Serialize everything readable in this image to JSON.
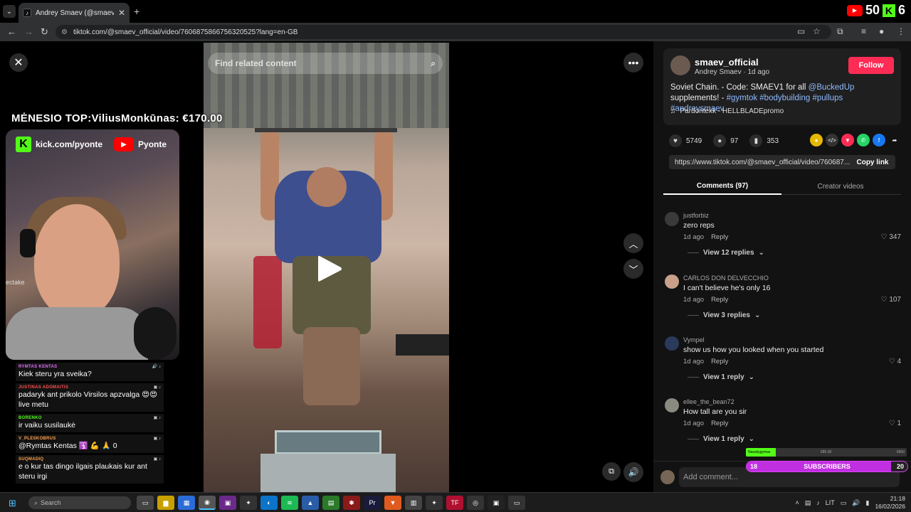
{
  "browser": {
    "tab_title": "Andrey Smaev (@smaev_of",
    "url": "tiktok.com/@smaev_official/video/7606875866756320525?lang=en-GB",
    "overlay_count_left": "50",
    "overlay_count_right": "6"
  },
  "video": {
    "search_placeholder": "Find related content"
  },
  "stream_overlay": {
    "banner": "MĖNESIO TOP:ViliusMonkūnas: €170.00",
    "kick_url": "kick.com/pyonte",
    "youtube_name": "Pyonte",
    "webcam_side_label": "ectake",
    "chat": [
      {
        "user": "RYMTAS KENTAS",
        "user_color": "#e56cff",
        "text": "Kiek steru yra sveika?"
      },
      {
        "user": "JUSTINAS ADOMAITIS",
        "user_color": "#ff4d4d",
        "text": "padaryk ant prikolo Virsilos apzvalga 😍😍 live metu"
      },
      {
        "user": "BORENKO",
        "user_color": "#53fc18",
        "text": "ir vaiku susilaukė"
      },
      {
        "user": "V_PLESKOBRUS",
        "user_color": "#ffa24d",
        "text": "@Rymtas Kentas 🛐 💪 🙏 0"
      },
      {
        "user": "SUQMADIQ",
        "user_color": "#ffa24d",
        "text": "e o kur tas dingo ilgais plaukais kur ant steru irgi"
      }
    ],
    "sub_goal": {
      "progress": 0.9,
      "current": "18",
      "label": "SUBSCRIBERS",
      "target": "20",
      "tip_label": "Nauskygymas",
      "tip_mid": "€85.00",
      "tip_right": "€500"
    }
  },
  "panel": {
    "handle": "smaev_official",
    "name": "Andrey Smaev",
    "posted": "1d ago",
    "follow_label": "Follow",
    "desc_text": "Soviet Chain. - Code: SMAEV1 for all ",
    "desc_mention": "@BuckedUp",
    "desc_text2": " supplements! - ",
    "desc_tags": "#gymtok #bodybuilding #pullups #andreysmaev",
    "music": "Pardontekk - HELLBLADEpromo",
    "likes": "5749",
    "comments": "97",
    "saves": "353",
    "share_link": "https://www.tiktok.com/@smaev_official/video/760687...",
    "copy_label": "Copy link",
    "tab_comments": "Comments (97)",
    "tab_videos": "Creator videos",
    "comment_placeholder": "Add comment...",
    "comment_list": [
      {
        "user": "justforbiz",
        "text": "zero reps",
        "age": "1d ago",
        "reply_label": "Reply",
        "likes": "347",
        "replies": "View 12 replies"
      },
      {
        "user": "CARLOS DON DELVECCHIO",
        "text": "I can't believe he's only 16",
        "age": "1d ago",
        "reply_label": "Reply",
        "likes": "107",
        "replies": "View 3 replies"
      },
      {
        "user": "Vympel",
        "text": "show us how you looked when you started",
        "age": "1d ago",
        "reply_label": "Reply",
        "likes": "4",
        "replies": "View 1 reply"
      },
      {
        "user": "ellee_the_bean72",
        "text": "How tall are you sir",
        "age": "1d ago",
        "reply_label": "Reply",
        "likes": "1",
        "replies": "View 1 reply"
      }
    ]
  },
  "taskbar": {
    "search_placeholder": "Search",
    "lang": "LIT",
    "time": "21:18",
    "date": "16/02/2026"
  }
}
